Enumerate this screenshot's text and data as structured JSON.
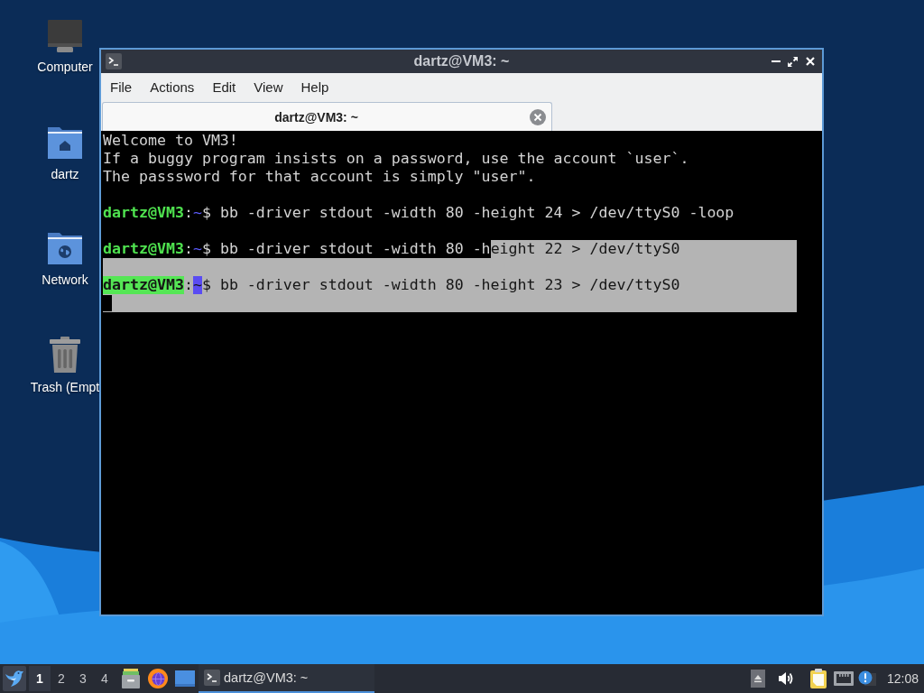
{
  "desktop": {
    "icons": [
      {
        "label": "Computer",
        "kind": "computer"
      },
      {
        "label": "dartz",
        "kind": "home"
      },
      {
        "label": "Network",
        "kind": "network"
      },
      {
        "label": "Trash (Empt",
        "kind": "trash"
      }
    ]
  },
  "window": {
    "title": "dartz@VM3: ~",
    "menu": [
      "File",
      "Actions",
      "Edit",
      "View",
      "Help"
    ],
    "tabs": [
      {
        "label": "dartz@VM3: ~",
        "selected": true
      }
    ],
    "terminal": {
      "lines": [
        {
          "segments": [
            {
              "kind": "text",
              "text": "Welcome to VM3!",
              "selected": false
            }
          ],
          "selected": false,
          "cursor": false
        },
        {
          "segments": [
            {
              "kind": "text",
              "text": "If a buggy program insists on a password, use the account `user`.",
              "selected": false
            }
          ],
          "selected": false,
          "cursor": false
        },
        {
          "segments": [
            {
              "kind": "text",
              "text": "The passsword for that account is simply \"user\".",
              "selected": false
            }
          ],
          "selected": false,
          "cursor": false
        },
        {
          "selected": false,
          "cursor": false
        },
        {
          "segments": [
            {
              "kind": "user",
              "text": "dartz@VM3",
              "selected": false
            },
            {
              "kind": "text",
              "text": ":",
              "selected": false
            },
            {
              "kind": "path",
              "text": "~",
              "selected": false
            },
            {
              "kind": "text",
              "text": "$ bb -driver stdout -width 80 -height 24 > /dev/ttyS0 -loop",
              "selected": false
            }
          ],
          "selected": false,
          "cursor": false
        },
        {
          "selected": false,
          "cursor": false
        },
        {
          "segments": [
            {
              "kind": "user",
              "text": "dartz@VM3",
              "selected": false
            },
            {
              "kind": "text",
              "text": ":",
              "selected": false
            },
            {
              "kind": "path",
              "text": "~",
              "selected": false
            },
            {
              "kind": "text",
              "text": "$ bb -driver stdout -width 80 -h",
              "selected": false
            },
            {
              "kind": "text",
              "text": "eight 22 > /dev/ttyS0",
              "selected": true
            }
          ],
          "selected": true,
          "cursor": false
        },
        {
          "selected": true,
          "cursor": false
        },
        {
          "segments": [
            {
              "kind": "user",
              "text": "dartz@VM3",
              "selected": true
            },
            {
              "kind": "text",
              "text": ":",
              "selected": true
            },
            {
              "kind": "path",
              "text": "~",
              "selected": true
            },
            {
              "kind": "text",
              "text": "$ bb -driver stdout -width 80 -height 23 > /dev/ttyS0",
              "selected": true
            }
          ],
          "selected": true,
          "cursor": false
        },
        {
          "selected": true,
          "cursor": true
        }
      ]
    }
  },
  "taskbar": {
    "workspaces": [
      {
        "label": "1",
        "selected": true
      },
      {
        "label": "2",
        "selected": false
      },
      {
        "label": "3",
        "selected": false
      },
      {
        "label": "4",
        "selected": false
      }
    ],
    "launchers": [
      {
        "kind": "files"
      },
      {
        "kind": "browser"
      },
      {
        "kind": "desktop"
      }
    ],
    "tasks": [
      {
        "label": "dartz@VM3: ~",
        "selected": true
      }
    ],
    "tray": [
      {
        "kind": "eject"
      },
      {
        "kind": "volume"
      },
      {
        "kind": "clipboard"
      },
      {
        "kind": "network"
      },
      {
        "kind": "notification"
      }
    ],
    "clock": "12:08"
  }
}
